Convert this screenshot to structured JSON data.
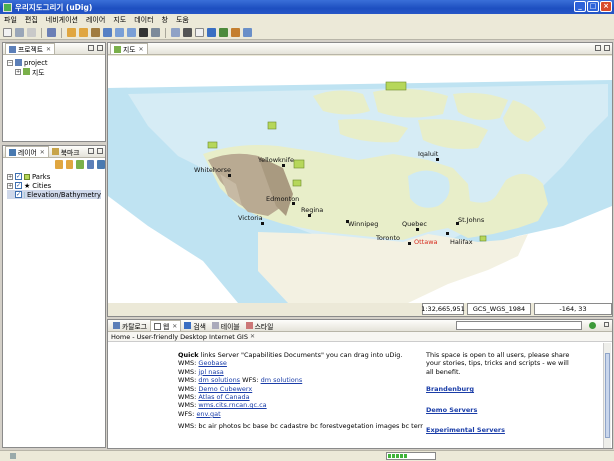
{
  "window": {
    "title": "우리지도그리기 (uDig)"
  },
  "menu": [
    "파일",
    "편집",
    "네비게이션",
    "레이어",
    "지도",
    "데이터",
    "창",
    "도움"
  ],
  "projects_panel": {
    "tab": "프로젝트",
    "root": "project",
    "child": "지도"
  },
  "layers_panel": {
    "tab": "레이어",
    "tab2": "북마크",
    "layers": [
      {
        "name": "Parks",
        "checked": true
      },
      {
        "name": "Cities",
        "checked": true
      },
      {
        "name": "Elevation/Bathymetry",
        "checked": true
      }
    ]
  },
  "map_panel": {
    "tab": "지도"
  },
  "cities": {
    "yellowknife": "Yellowknife",
    "whitehorse": "Whitehorse",
    "iqaluit": "Iqaluit",
    "edmonton": "Edmonton",
    "regina": "Regina",
    "victoria": "Victoria",
    "winnipeg": "Winnipeg",
    "quebec": "Quebec",
    "stjohns": "St.Johns",
    "toronto": "Toronto",
    "ottawa": "Ottawa",
    "halifax": "Halifax"
  },
  "status": {
    "scale": "1:32,665,951",
    "crs": "GCS_WGS_1984",
    "coords": "-164, 33"
  },
  "bottom_tabs": [
    "카탈로그",
    "웹",
    "검색",
    "테이블",
    "스타일"
  ],
  "browser": {
    "title": "Home - User-friendly Desktop Internet GIS",
    "quick_bold": "Quick",
    "quick_rest": " links Server \"Capabilities Documents\" you can drag into uDig.",
    "links": [
      {
        "prefix": "WMS: ",
        "link": "Geobase",
        "suffix": ""
      },
      {
        "prefix": "WMS: ",
        "link": "jpl nasa",
        "suffix": ""
      },
      {
        "prefix": "WMS: ",
        "link": "dm solutions",
        "suffix": " WFS: ",
        "link2": "dm solutions"
      },
      {
        "prefix": "WMS: ",
        "link": "Demo Cubewerx",
        "suffix": ""
      },
      {
        "prefix": "WMS: ",
        "link": "Atlas of Canada",
        "suffix": ""
      },
      {
        "prefix": "WMS: ",
        "link": "wms.cits.rncan.gc.ca",
        "suffix": ""
      },
      {
        "prefix": "WFS: ",
        "link": "env.gat",
        "suffix": ""
      }
    ],
    "truncated_line": "WMS: bc air photos bc base bc cadastre bc forestvegetation images bc terrestrial ecolor bc",
    "right_text": "This space is open to all users, please share your stories, tips, tricks and scripts - we will all benefit.",
    "right_links": [
      "Brandenburg",
      "Demo Servers",
      "Experimental Servers"
    ]
  },
  "colors": {
    "title_bar": "#1d4fc0",
    "ocean": "#bfe3f2",
    "land": "#e8eec9",
    "ottawa": "#d62b1e"
  }
}
